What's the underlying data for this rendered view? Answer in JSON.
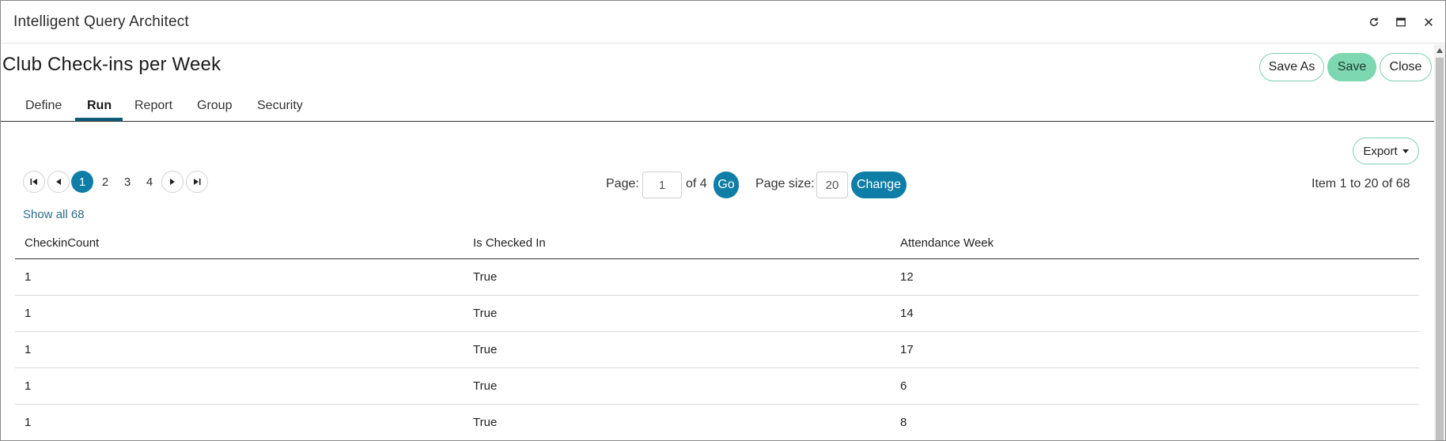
{
  "window": {
    "title": "Intelligent Query Architect",
    "controls": [
      "refresh-icon",
      "maximize-icon",
      "close-icon"
    ]
  },
  "report": {
    "title": "Club Check-ins per Week",
    "buttons": {
      "save_as": "Save As",
      "save": "Save",
      "close": "Close"
    }
  },
  "tabs": [
    {
      "label": "Define",
      "active": false
    },
    {
      "label": "Run",
      "active": true
    },
    {
      "label": "Report",
      "active": false
    },
    {
      "label": "Group",
      "active": false
    },
    {
      "label": "Security",
      "active": false
    }
  ],
  "toolbar": {
    "export_label": "Export"
  },
  "pager": {
    "pages": [
      "1",
      "2",
      "3",
      "4"
    ],
    "current_page": "1",
    "page_label": "Page:",
    "page_value": "1",
    "of_label": "of 4",
    "go_label": "Go",
    "page_size_label": "Page size:",
    "page_size_value": "20",
    "change_label": "Change",
    "item_range": "Item 1 to 20 of 68",
    "show_all": "Show all 68"
  },
  "table": {
    "columns": [
      "CheckinCount",
      "Is Checked In",
      "Attendance Week"
    ],
    "rows": [
      [
        "1",
        "True",
        "12"
      ],
      [
        "1",
        "True",
        "14"
      ],
      [
        "1",
        "True",
        "17"
      ],
      [
        "1",
        "True",
        "6"
      ],
      [
        "1",
        "True",
        "8"
      ]
    ]
  },
  "colors": {
    "accent": "#0f7ea6",
    "save_button": "#7dd7b0",
    "outline_button": "#7fcfae",
    "tab_underline": "#0f5a78"
  }
}
